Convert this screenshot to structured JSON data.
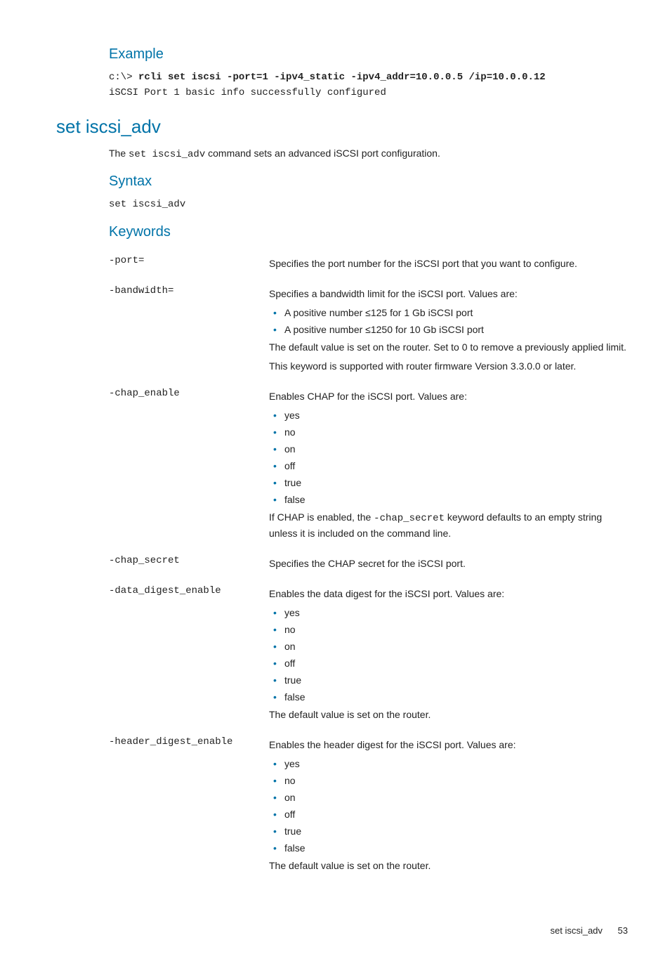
{
  "example": {
    "heading": "Example",
    "prompt": "c:\\> ",
    "command": "rcli set iscsi -port=1 -ipv4_static -ipv4_addr=10.0.0.5 /ip=10.0.0.12",
    "output": "iSCSI Port 1 basic info successfully configured"
  },
  "section": {
    "heading": "set iscsi_adv",
    "intro_pre": "The ",
    "intro_code": "set iscsi_adv",
    "intro_post": " command sets an advanced iSCSI port configuration."
  },
  "syntax": {
    "heading": "Syntax",
    "text": "set iscsi_adv"
  },
  "keywords": {
    "heading": "Keywords",
    "rows": [
      {
        "name": "-port=",
        "desc": "Specifies the port number for the iSCSI port that you want to configure."
      },
      {
        "name": "-bandwidth=",
        "desc": "Specifies a bandwidth limit for the iSCSI port. Values are:",
        "bullets": [
          "A positive number ≤125 for 1 Gb iSCSI port",
          "A positive number ≤1250 for 10 Gb iSCSI port"
        ],
        "post1": "The default value is set on the router. Set to 0 to remove a previously applied limit.",
        "post2": "This keyword is supported with router firmware Version 3.3.0.0 or later."
      },
      {
        "name": "-chap_enable",
        "desc": "Enables CHAP for the iSCSI port. Values are:",
        "bullets": [
          "yes",
          "no",
          "on",
          "off",
          "true",
          "false"
        ],
        "chap_note_pre": "If CHAP is enabled, the ",
        "chap_note_code": "-chap_secret",
        "chap_note_post": " keyword defaults to an empty string unless it is included on the command line."
      },
      {
        "name": "-chap_secret",
        "desc": "Specifies the CHAP secret for the iSCSI port."
      },
      {
        "name": "-data_digest_enable",
        "desc": "Enables the data digest for the iSCSI port. Values are:",
        "bullets": [
          "yes",
          "no",
          "on",
          "off",
          "true",
          "false"
        ],
        "post1": "The default value is set on the router."
      },
      {
        "name": "-header_digest_enable",
        "desc": "Enables the header digest for the iSCSI port. Values are:",
        "bullets": [
          "yes",
          "no",
          "on",
          "off",
          "true",
          "false"
        ],
        "post1": "The default value is set on the router."
      }
    ]
  },
  "footer": {
    "cmd": "set iscsi_adv",
    "page": "53"
  }
}
